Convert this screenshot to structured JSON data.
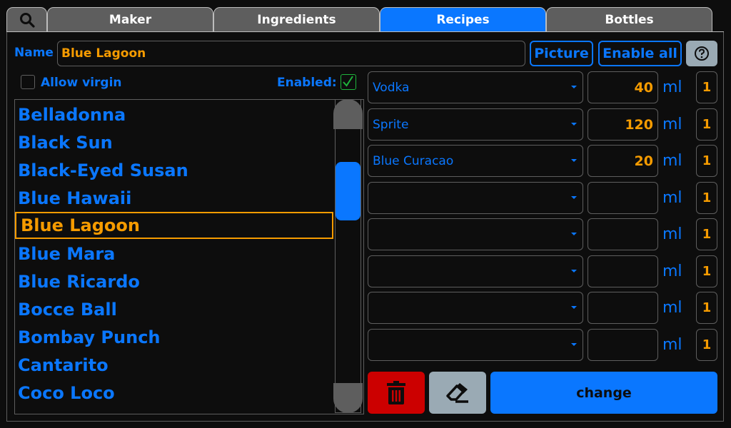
{
  "colors": {
    "accent": "#0a77ff",
    "highlight": "#f59b00",
    "danger": "#cc0000",
    "neutral": "#9aaab4",
    "enabled_check": "#1fb43c"
  },
  "tabs": [
    {
      "id": "search",
      "icon": "search-icon"
    },
    {
      "id": "maker",
      "label": "Maker"
    },
    {
      "id": "ingredients",
      "label": "Ingredients"
    },
    {
      "id": "recipes",
      "label": "Recipes",
      "active": true
    },
    {
      "id": "bottles",
      "label": "Bottles"
    }
  ],
  "name_label": "Name",
  "name_value": "Blue Lagoon",
  "buttons": {
    "picture": "Picture",
    "enable_all": "Enable all",
    "help_icon": "help-circle-icon",
    "delete_icon": "trash-icon",
    "clear_icon": "eraser-icon",
    "change": "change"
  },
  "allow_virgin": {
    "label": "Allow virgin",
    "checked": false
  },
  "enabled": {
    "label": "Enabled:",
    "checked": true
  },
  "recipe_list": {
    "items": [
      "Belladonna",
      "Black Sun",
      "Black-Eyed Susan",
      "Blue Hawaii",
      "Blue Lagoon",
      "Blue Mara",
      "Blue Ricardo",
      "Bocce Ball",
      "Bombay Punch",
      "Cantarito",
      "Coco Loco"
    ],
    "selected": "Blue Lagoon"
  },
  "ingredients": [
    {
      "name": "Vodka",
      "amount": "40",
      "unit": "ml",
      "priority": "1"
    },
    {
      "name": "Sprite",
      "amount": "120",
      "unit": "ml",
      "priority": "1"
    },
    {
      "name": "Blue Curacao",
      "amount": "20",
      "unit": "ml",
      "priority": "1"
    },
    {
      "name": "",
      "amount": "",
      "unit": "ml",
      "priority": "1"
    },
    {
      "name": "",
      "amount": "",
      "unit": "ml",
      "priority": "1"
    },
    {
      "name": "",
      "amount": "",
      "unit": "ml",
      "priority": "1"
    },
    {
      "name": "",
      "amount": "",
      "unit": "ml",
      "priority": "1"
    },
    {
      "name": "",
      "amount": "",
      "unit": "ml",
      "priority": "1"
    }
  ]
}
